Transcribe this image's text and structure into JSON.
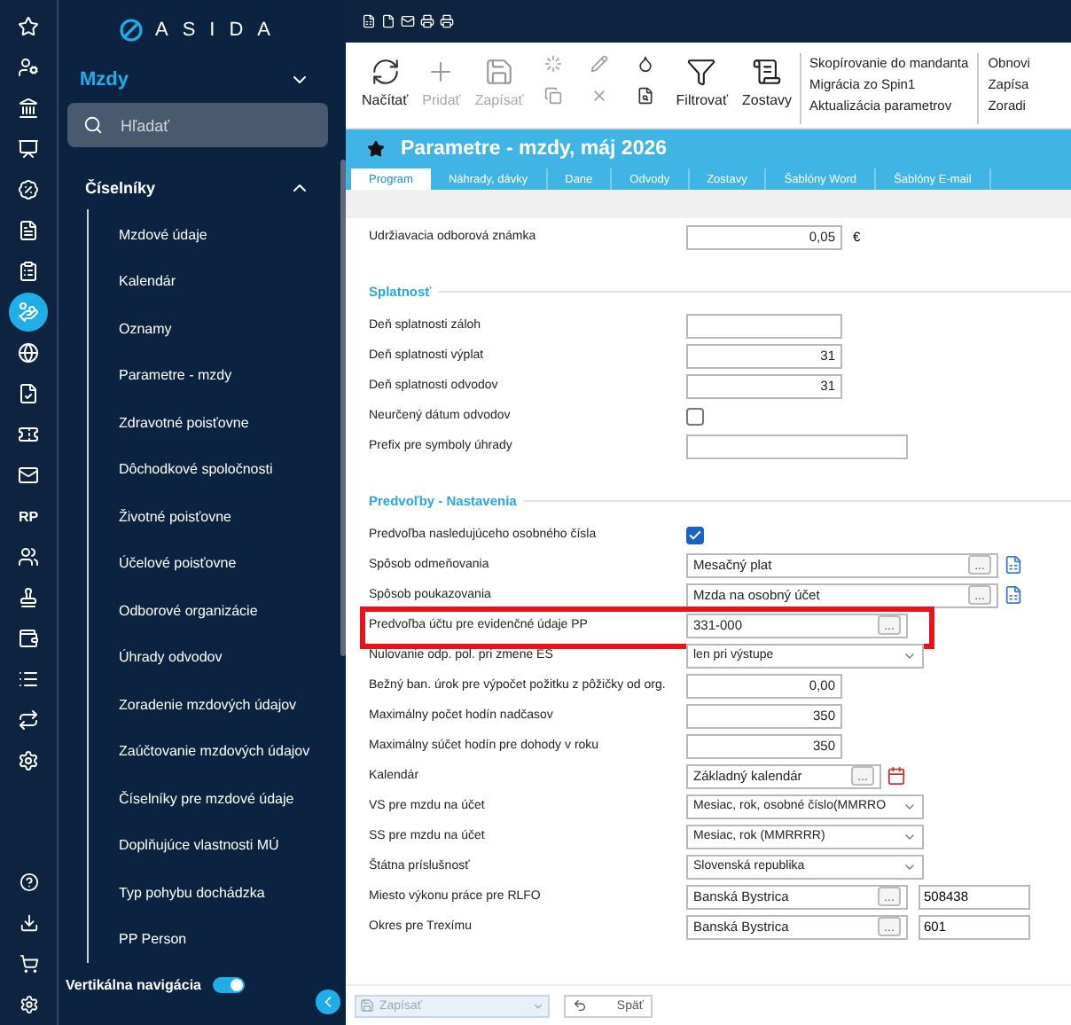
{
  "rail": [
    {
      "selected": false
    },
    {
      "selected": false
    },
    {
      "selected": false
    },
    {
      "selected": false
    },
    {
      "selected": false
    },
    {
      "selected": false
    },
    {
      "selected": false
    },
    {
      "selected": true
    },
    {
      "selected": false
    },
    {
      "selected": false
    },
    {
      "selected": false
    },
    {
      "selected": false
    },
    {
      "selected": false,
      "label": "RP"
    },
    {
      "selected": false
    },
    {
      "selected": false
    },
    {
      "selected": false
    },
    {
      "selected": false
    },
    {
      "selected": false
    },
    {
      "selected": false
    }
  ],
  "nav": {
    "logo": "ASIDA",
    "module": "Mzdy",
    "search": {
      "placeholder": "Hľadať"
    },
    "group": {
      "title": "Číselníky",
      "expanded": true,
      "items": [
        {
          "label": "Mzdové údaje"
        },
        {
          "label": "Kalendár"
        },
        {
          "label": "Oznamy"
        },
        {
          "label": "Parametre - mzdy"
        },
        {
          "label": "Zdravotné poisťovne"
        },
        {
          "label": "Dôchodkové spoločnosti"
        },
        {
          "label": "Životné poisťovne"
        },
        {
          "label": "Účelové poisťovne"
        },
        {
          "label": "Odborové organizácie"
        },
        {
          "label": "Úhrady odvodov"
        },
        {
          "label": "Zoradenie mzdových údajov"
        },
        {
          "label": "Zaúčtovanie mzdových údajov"
        },
        {
          "label": "Číselníky pre mzdové údaje"
        },
        {
          "label": "Doplňujúce vlastnosti MÚ"
        },
        {
          "label": "Typ pohybu dochádzka"
        },
        {
          "label": "PP Person"
        }
      ]
    },
    "vertical_nav": {
      "label": "Vertikálna navigácia",
      "on": true
    }
  },
  "toolbar": {
    "buttons": [
      {
        "label": "Načítať",
        "disabled": false
      },
      {
        "label": "Pridať",
        "disabled": true
      },
      {
        "label": "Zapísať",
        "disabled": true
      }
    ],
    "buttons2": [
      {
        "label": "Filtrovať",
        "disabled": false
      },
      {
        "label": "Zostavy",
        "disabled": false
      }
    ],
    "links": [
      "Skopírovanie do mandanta",
      "Migrácia zo Spin1",
      "Aktualizácia parametrov"
    ],
    "links2": [
      "Obnovi",
      "Zapísa",
      "Zoradi"
    ]
  },
  "header": {
    "title": "Parametre - mzdy, máj 2026"
  },
  "tabs": [
    {
      "label": "Program",
      "selected": true
    },
    {
      "label": "Náhrady, dávky",
      "selected": false
    },
    {
      "label": "Dane",
      "selected": false
    },
    {
      "label": "Odvody",
      "selected": false
    },
    {
      "label": "Zostavy",
      "selected": false
    },
    {
      "label": "Šablóny Word",
      "selected": false
    },
    {
      "label": "Šablóny E-mail",
      "selected": false
    }
  ],
  "form": {
    "rows": [
      {
        "kind": "number",
        "label": "Udržiavacia odborová známka",
        "value": "0,05",
        "unit": "€"
      },
      {
        "kind": "section",
        "label": "Splatnosť"
      },
      {
        "kind": "number",
        "label": "Deň splatnosti záloh"
      },
      {
        "kind": "number",
        "label": "Deň splatnosti výplat",
        "value": "31"
      },
      {
        "kind": "number",
        "label": "Deň splatnosti odvodov",
        "value": "31"
      },
      {
        "kind": "checkbox",
        "label": "Neurčený dátum odvodov",
        "checked": false
      },
      {
        "kind": "text",
        "label": "Prefix pre symboly úhrady"
      },
      {
        "kind": "section",
        "label": "Predvoľby - Nastavenia"
      },
      {
        "kind": "checkbox",
        "label": "Predvoľba nasledujúceho osobného čísla",
        "checked": true
      },
      {
        "kind": "lookup",
        "label": "Spôsob odmeňovania",
        "value": "Mesačný plat",
        "browse": "...",
        "wide": true,
        "add_record": true
      },
      {
        "kind": "lookup",
        "label": "Spôsob poukazovania",
        "value": "Mzda na osobný účet",
        "browse": "...",
        "wide": true,
        "add_record": true
      },
      {
        "kind": "lookup",
        "label": "Predvoľba účtu pre evidenčné údaje PP",
        "value": "331-000",
        "browse": "...",
        "highlighted": true
      },
      {
        "kind": "dropdown",
        "label": "Nulovanie odp. pol. pri zmene ES",
        "value": "len pri výstupe"
      },
      {
        "kind": "number",
        "label": "Bežný ban. úrok pre výpočet požitku z pôžičky od org.",
        "value": "0,00"
      },
      {
        "kind": "number",
        "label": "Maximálny počet hodín nadčasov",
        "value": "350"
      },
      {
        "kind": "number",
        "label": "Maximálny súčet hodín pre dohody v roku",
        "value": "350"
      },
      {
        "kind": "lookup",
        "label": "Kalendár",
        "value": "Základný kalendár",
        "browse": "...",
        "calendar": true
      },
      {
        "kind": "dropdown",
        "label": "VS pre mzdu na účet",
        "value": "Mesiac, rok, osobné číslo(MMRRO"
      },
      {
        "kind": "dropdown",
        "label": "SS pre mzdu na účet",
        "value": "Mesiac, rok (MMRRRR)"
      },
      {
        "kind": "dropdown",
        "label": "Štátna príslušnosť",
        "value": "Slovenská republika"
      },
      {
        "kind": "lookup",
        "label": "Miesto výkonu práce pre RLFO",
        "value": "Banská Bystrica",
        "browse": "...",
        "code": "508438"
      },
      {
        "kind": "lookup",
        "label": "Okres pre Trexímu",
        "value": "Banská Bystrica",
        "browse": "...",
        "code": "601"
      }
    ]
  },
  "footer": {
    "save": {
      "label": "Zapísať",
      "disabled": true
    },
    "back": {
      "label": "Späť"
    }
  }
}
